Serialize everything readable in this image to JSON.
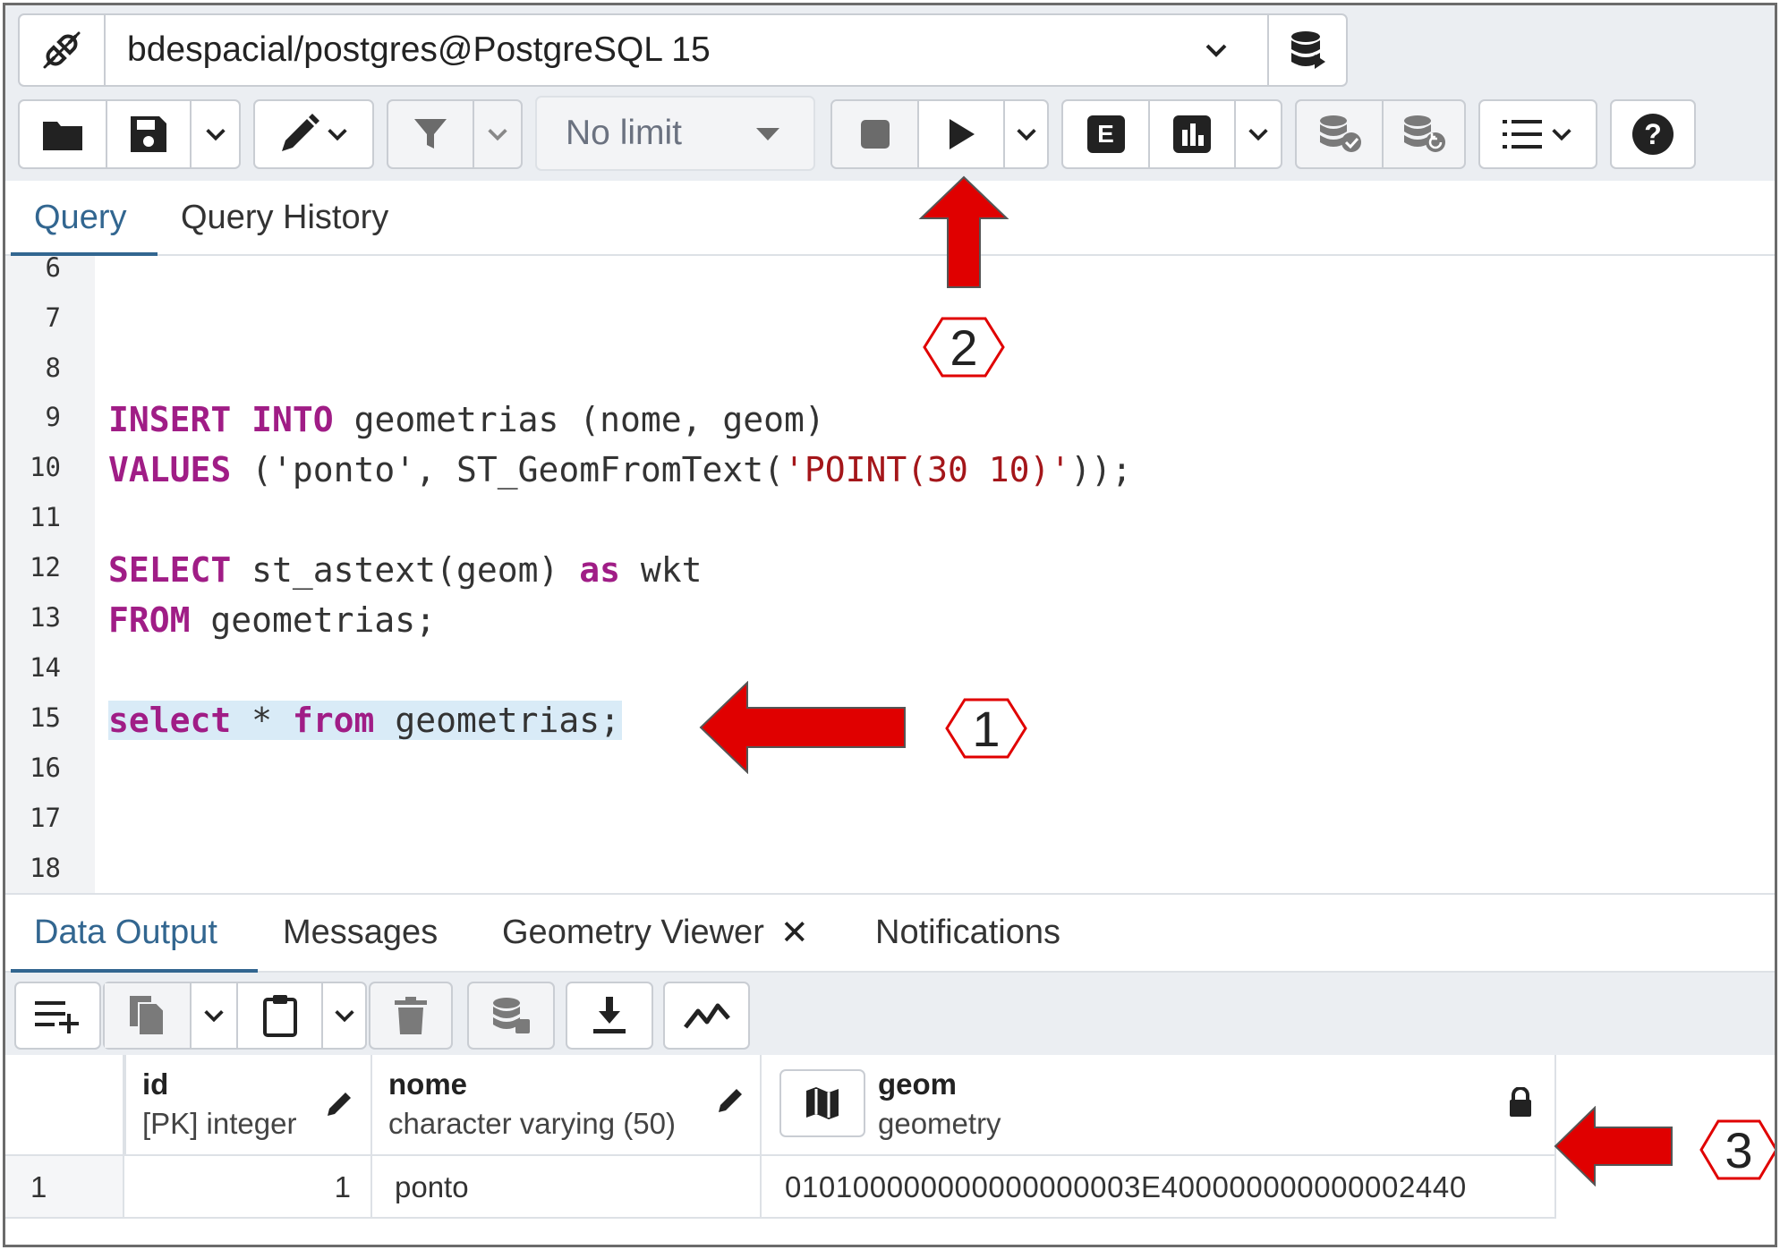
{
  "connection": {
    "label": "bdespacial/postgres@PostgreSQL 15",
    "icon": "connection-icon",
    "dropdown_icon": "chevron-down-icon",
    "db_icon": "database-icon"
  },
  "toolbar": {
    "open_icon": "folder-icon",
    "save_icon": "save-icon",
    "edit_icon": "pencil-icon",
    "filter_icon": "filter-icon",
    "limit_label": "No limit",
    "stop_icon": "stop-icon",
    "execute_icon": "play-icon",
    "explain_label": "E",
    "explain_analyze_icon": "bar-chart-icon",
    "commit_icon": "commit-icon",
    "rollback_icon": "rollback-icon",
    "macros_icon": "list-icon",
    "help_label": "?"
  },
  "editor_tabs": [
    {
      "label": "Query",
      "active": true
    },
    {
      "label": "Query History",
      "active": false
    }
  ],
  "editor": {
    "line_numbers": [
      "6",
      "7",
      "8",
      "9",
      "10",
      "11",
      "12",
      "13",
      "14",
      "15",
      "16",
      "17",
      "18"
    ],
    "line9": {
      "kw1": "INSERT",
      "kw2": "INTO",
      "rest": "geometrias (nome, geom)"
    },
    "line10": {
      "kw": "VALUES",
      "p1": " ('ponto', ST_GeomFromText(",
      "str": "'POINT(30 10)'",
      "p2": "));"
    },
    "line12": {
      "kw": "SELECT",
      "mid": " st_astext(geom) ",
      "kw2": "as",
      "end": " wkt"
    },
    "line13": {
      "kw": "FROM",
      "rest": " geometrias;"
    },
    "line15": {
      "kw": "select",
      "mid": " * ",
      "kw2": "from",
      "rest": " geometrias;"
    }
  },
  "output_tabs": [
    {
      "label": "Data Output",
      "active": true
    },
    {
      "label": "Messages",
      "active": false
    },
    {
      "label": "Geometry Viewer",
      "active": false,
      "close": "✕"
    },
    {
      "label": "Notifications",
      "active": false
    }
  ],
  "grid": {
    "columns": [
      {
        "name": "id",
        "type": "[PK] integer"
      },
      {
        "name": "nome",
        "type": "character varying (50)"
      },
      {
        "name": "geom",
        "type": "geometry"
      }
    ],
    "rows": [
      {
        "row_num": "1",
        "id": "1",
        "nome": "ponto",
        "geom": "010100000000000000003E400000000000002440"
      }
    ]
  },
  "annotations": [
    {
      "number": "1"
    },
    {
      "number": "2"
    },
    {
      "number": "3"
    }
  ],
  "colors": {
    "accent": "#326690",
    "keyword": "#a01d86",
    "string": "#a4161a",
    "arrow": "#e00000",
    "toolbar_bg": "#ebeef2"
  }
}
